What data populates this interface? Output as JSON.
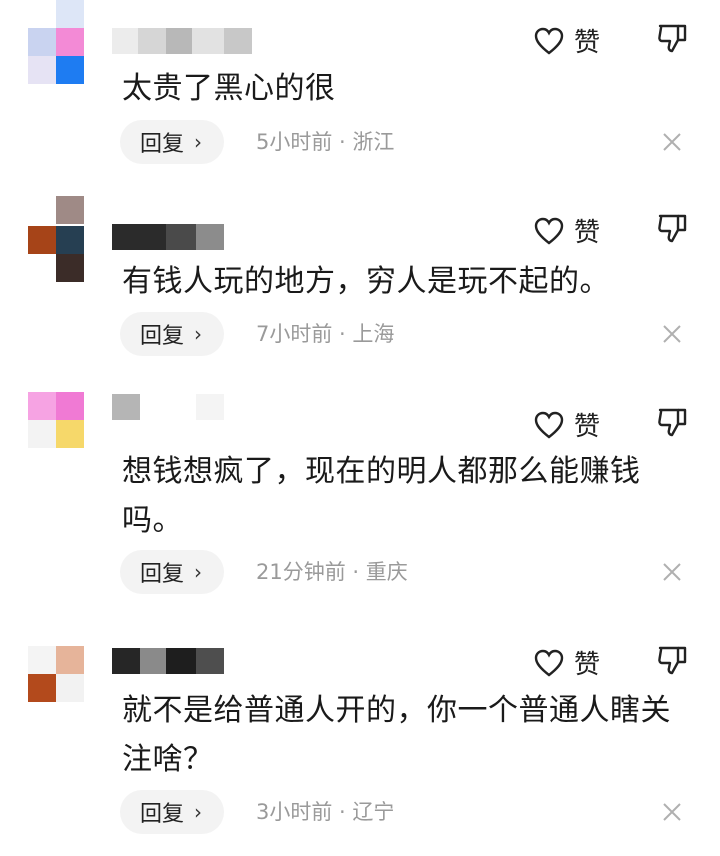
{
  "like_label": "赞",
  "reply_label": "回复",
  "comments": [
    {
      "text": "太贵了黑心的很",
      "time": "5小时前",
      "location": "浙江"
    },
    {
      "text": "有钱人玩的地方，穷人是玩不起的。",
      "time": "7小时前",
      "location": "上海"
    },
    {
      "text": "想钱想疯了，现在的明人都那么能赚钱吗。",
      "time": "21分钟前",
      "location": "重庆"
    },
    {
      "text": "就不是给普通人开的，你一个普通人瞎关注啥？",
      "time": "3小时前",
      "location": "辽宁"
    }
  ],
  "separator": " · "
}
